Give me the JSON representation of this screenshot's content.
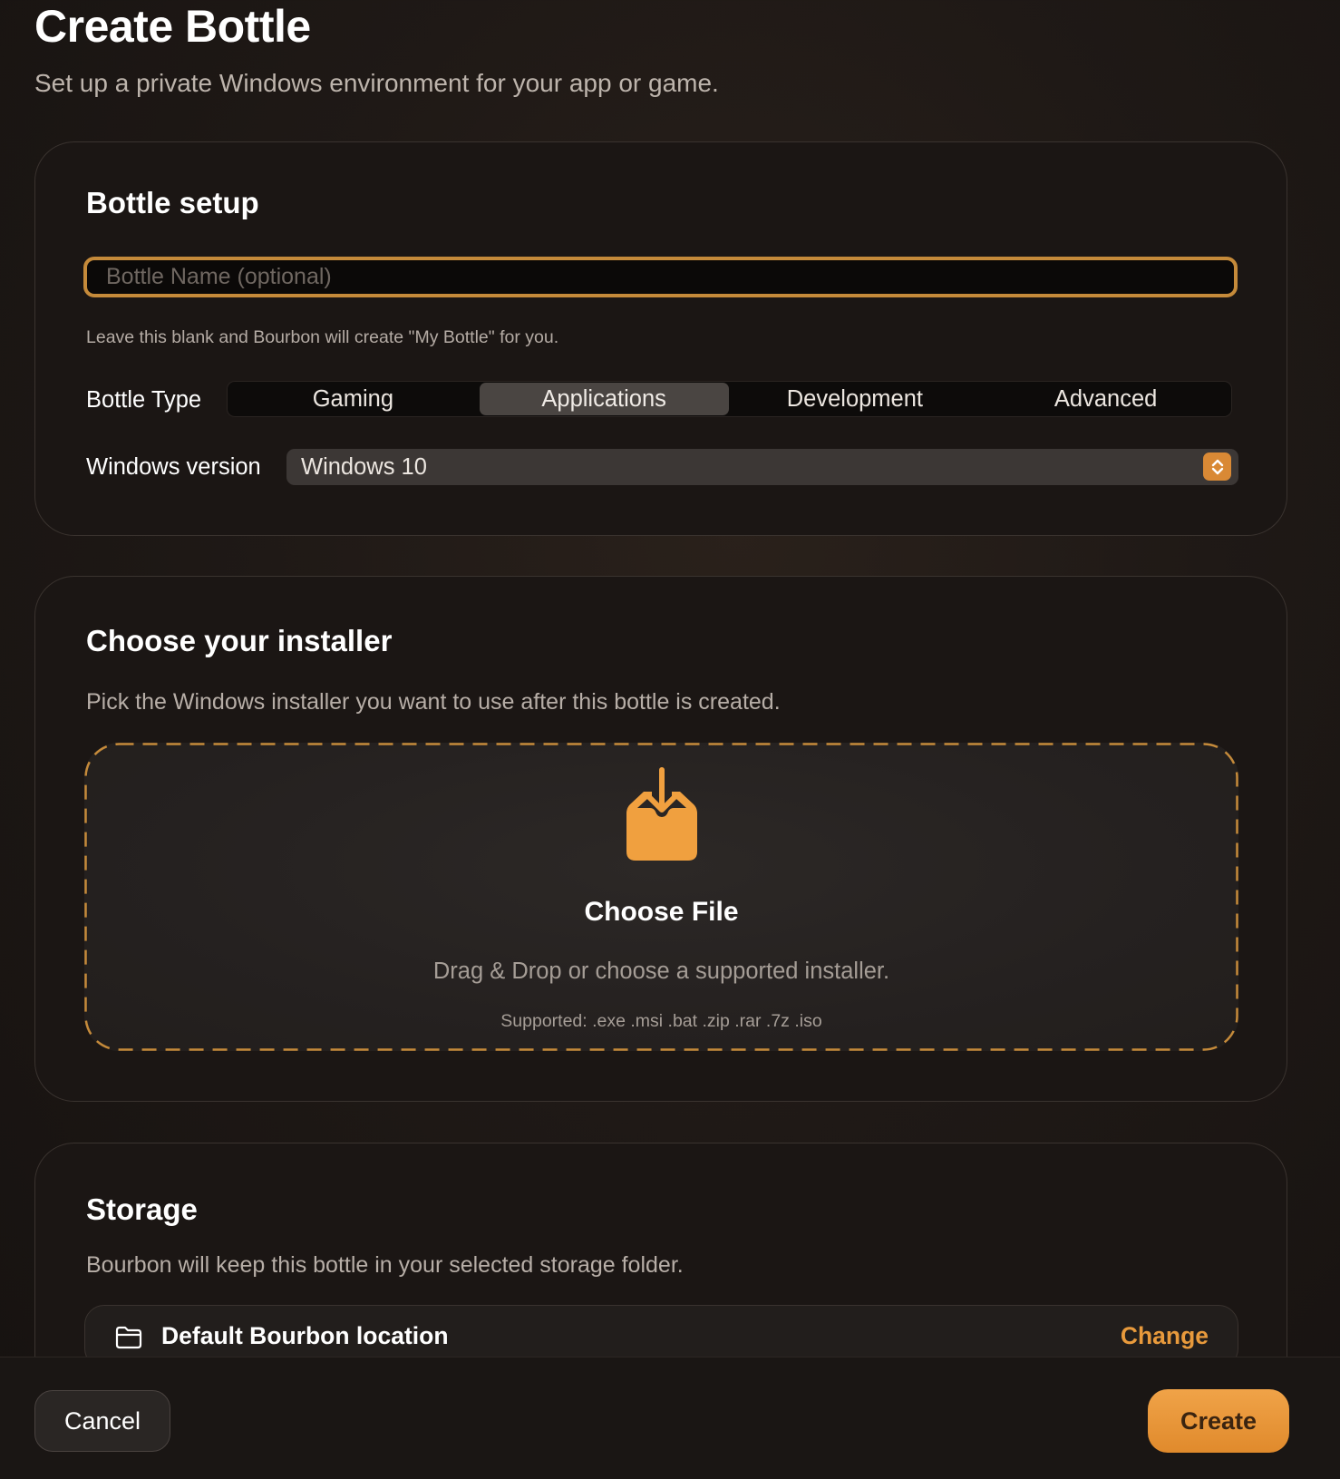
{
  "header": {
    "title": "Create Bottle",
    "subtitle": "Set up a private Windows environment for your app or game."
  },
  "setup": {
    "title": "Bottle setup",
    "name_placeholder": "Bottle Name (optional)",
    "name_value": "",
    "hint": "Leave this blank and Bourbon will create \"My Bottle\" for you.",
    "type_label": "Bottle Type",
    "types": [
      "Gaming",
      "Applications",
      "Development",
      "Advanced"
    ],
    "selected_type": "Applications",
    "version_label": "Windows version",
    "version_value": "Windows 10"
  },
  "installer": {
    "title": "Choose your installer",
    "description": "Pick the Windows installer you want to use after this bottle is created.",
    "choose_label": "Choose File",
    "drop_text": "Drag & Drop or choose a supported installer.",
    "supported_text": "Supported: .exe .msi .bat .zip .rar .7z .iso",
    "icon": "tray-download-icon"
  },
  "storage": {
    "title": "Storage",
    "description": "Bourbon will keep this bottle in your selected storage folder.",
    "location_label": "Default Bourbon location",
    "change_label": "Change",
    "icon": "folder-icon"
  },
  "footer": {
    "cancel_label": "Cancel",
    "create_label": "Create"
  },
  "colors": {
    "accent": "#e89a3c",
    "input_border": "#c58a3a",
    "background": "#1b1614"
  }
}
